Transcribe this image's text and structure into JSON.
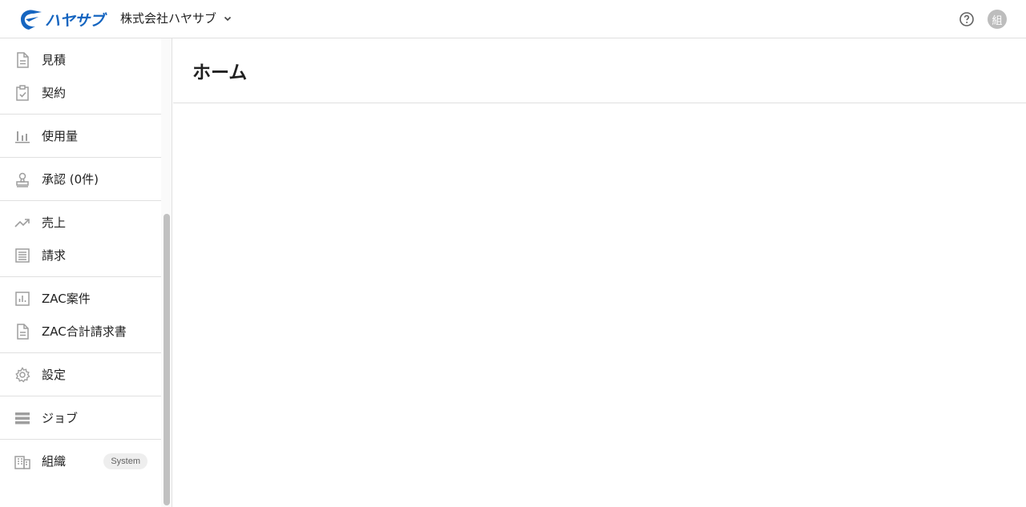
{
  "header": {
    "logo_text": "ハヤサブ",
    "org_name": "株式会社ハヤサブ",
    "avatar_text": "組"
  },
  "sidebar": {
    "groups": [
      {
        "items": [
          {
            "label": "見積",
            "icon": "document-icon"
          },
          {
            "label": "契約",
            "icon": "clipboard-check-icon"
          }
        ]
      },
      {
        "items": [
          {
            "label": "使用量",
            "icon": "bar-chart-icon"
          }
        ]
      },
      {
        "items": [
          {
            "label": "承認 (0件)",
            "icon": "stamp-icon"
          }
        ]
      },
      {
        "items": [
          {
            "label": "売上",
            "icon": "trending-up-icon"
          },
          {
            "label": "請求",
            "icon": "list-document-icon"
          }
        ]
      },
      {
        "items": [
          {
            "label": "ZAC案件",
            "icon": "chart-box-icon"
          },
          {
            "label": "ZAC合計請求書",
            "icon": "document-icon"
          }
        ]
      },
      {
        "items": [
          {
            "label": "設定",
            "icon": "gear-icon"
          }
        ]
      },
      {
        "items": [
          {
            "label": "ジョブ",
            "icon": "server-icon"
          }
        ]
      },
      {
        "items": [
          {
            "label": "組織",
            "icon": "building-icon",
            "badge": "System"
          }
        ]
      }
    ]
  },
  "main": {
    "title": "ホーム"
  },
  "colors": {
    "brand": "#1565c0",
    "icon": "#9e9e9e",
    "divider": "#e0e0e0"
  }
}
